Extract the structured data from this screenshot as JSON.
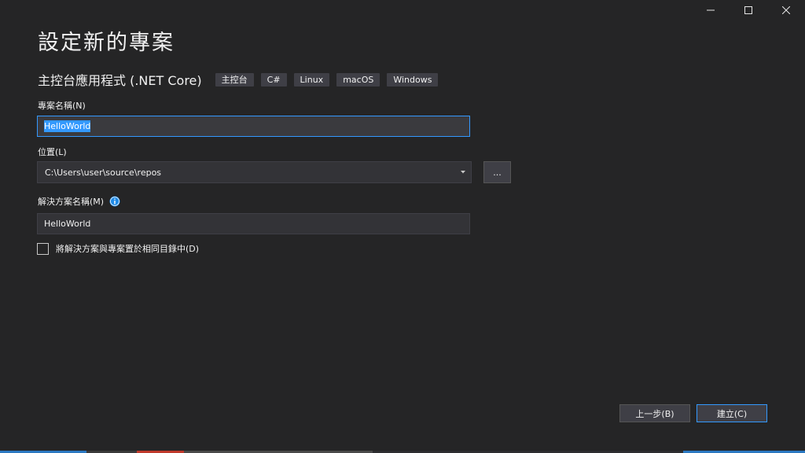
{
  "window": {
    "controls": {
      "minimize_icon": "minimize-icon",
      "maximize_icon": "maximize-icon",
      "close_icon": "close-icon"
    }
  },
  "page": {
    "title": "設定新的專案"
  },
  "template": {
    "name": "主控台應用程式 (.NET Core)",
    "tags": [
      "主控台",
      "C#",
      "Linux",
      "macOS",
      "Windows"
    ]
  },
  "form": {
    "project_name_label": "專案名稱(N)",
    "project_name_value": "HelloWorld",
    "location_label": "位置(L)",
    "location_value": "C:\\Users\\user\\source\\repos",
    "browse_label": "...",
    "solution_name_label": "解決方案名稱(M)",
    "solution_name_value": "HelloWorld",
    "same_dir_checkbox_label": "將解決方案與專案置於相同目錄中(D)",
    "same_dir_checked": false
  },
  "footer": {
    "back_label": "上一步(B)",
    "create_label": "建立(C)"
  },
  "colors": {
    "background": "#252526",
    "input_bg": "#333337",
    "accent": "#3399ff",
    "tag_bg": "#3f3f46"
  }
}
